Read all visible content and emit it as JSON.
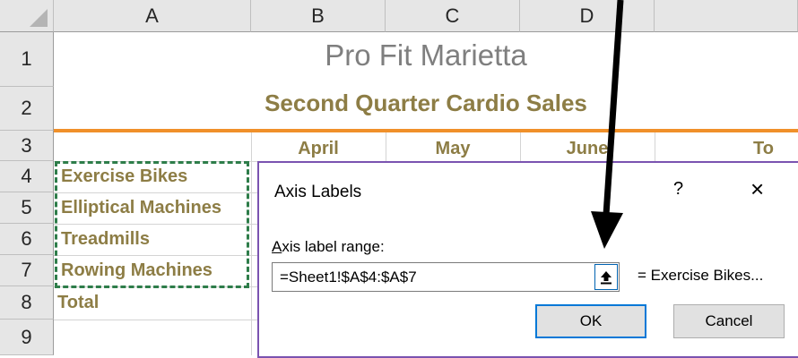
{
  "columns": [
    "A",
    "B",
    "C",
    "D"
  ],
  "rows": [
    "1",
    "2",
    "3",
    "4",
    "5",
    "6",
    "7",
    "8",
    "9"
  ],
  "sheet": {
    "title": "Pro Fit Marietta",
    "subtitle": "Second Quarter Cardio Sales",
    "months": [
      "April",
      "May",
      "June",
      "To"
    ],
    "row_labels": [
      "Exercise Bikes",
      "Elliptical Machines",
      "Treadmills",
      "Rowing Machines",
      "Total"
    ]
  },
  "dialog": {
    "title": "Axis Labels",
    "help": "?",
    "close": "×",
    "range_label_underlined": "A",
    "range_label_rest": "xis label range:",
    "range_value": "=Sheet1!$A$4:$A$7",
    "preview": "= Exercise Bikes...",
    "ok": "OK",
    "cancel": "Cancel"
  },
  "icons": {
    "collapse": "collapse-dialog-icon",
    "arrow": "annotation-arrow"
  },
  "colors": {
    "accent_text": "#8d7d45",
    "title_gray": "#7f7f7f",
    "orange_rule": "#f0902a",
    "marquee": "#2e7d4a",
    "dialog_border": "#7a53b0",
    "ok_focus": "#0078d7"
  }
}
